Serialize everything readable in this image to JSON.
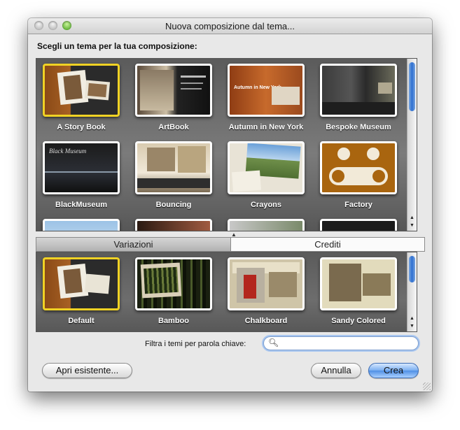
{
  "window": {
    "title": "Nuova composizione dal tema..."
  },
  "prompt": "Scegli un tema per la tua composizione:",
  "themes": [
    {
      "label": "A Story Book",
      "selected": true,
      "thumb_text": ""
    },
    {
      "label": "ArtBook",
      "selected": false,
      "thumb_text": ""
    },
    {
      "label": "Autumn in New York",
      "selected": false,
      "thumb_text": "Autumn in New York"
    },
    {
      "label": "Bespoke Museum",
      "selected": false,
      "thumb_text": ""
    },
    {
      "label": "BlackMuseum",
      "selected": false,
      "thumb_text": "Black Museum"
    },
    {
      "label": "Bouncing",
      "selected": false,
      "thumb_text": ""
    },
    {
      "label": "Crayons",
      "selected": false,
      "thumb_text": ""
    },
    {
      "label": "Factory",
      "selected": false,
      "thumb_text": ""
    }
  ],
  "tabs": [
    {
      "label": "Variazioni"
    },
    {
      "label": "Crediti"
    }
  ],
  "variations": [
    {
      "label": "Default",
      "selected": true
    },
    {
      "label": "Bamboo",
      "selected": false
    },
    {
      "label": "Chalkboard",
      "selected": false
    },
    {
      "label": "Sandy Colored",
      "selected": false
    }
  ],
  "filter": {
    "label": "Filtra i temi per parola chiave:",
    "value": ""
  },
  "buttons": {
    "open": "Apri esistente...",
    "cancel": "Annulla",
    "create": "Crea"
  },
  "colors": {
    "selection": "#f0d224",
    "accent": "#4f8fe5",
    "gallery_bg": "#6a6a6a"
  },
  "icons": {
    "search": "search-icon",
    "scroll_up": "arrow-up-icon",
    "scroll_down": "arrow-down-icon"
  }
}
